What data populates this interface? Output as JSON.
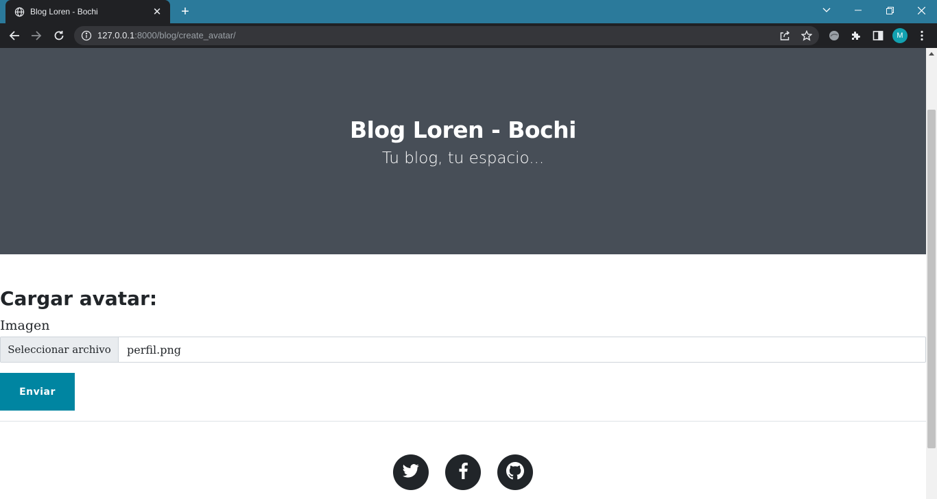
{
  "browser": {
    "tab_title": "Blog Loren - Bochi",
    "url_host": "127.0.0.1",
    "url_rest": ":8000/blog/create_avatar/",
    "profile_initial": "M",
    "accent_color": "#2b7a9b"
  },
  "masthead": {
    "title": "Blog Loren - Bochi",
    "subtitle": "Tu blog, tu espacio..."
  },
  "form": {
    "heading": "Cargar avatar:",
    "field_label": "Imagen",
    "file_button": "Seleccionar archivo",
    "file_name": "perfil.png",
    "submit_label": "Enviar",
    "submit_color": "#0085a1"
  },
  "footer": {
    "social_icons": [
      "twitter-icon",
      "facebook-icon",
      "github-icon"
    ]
  }
}
